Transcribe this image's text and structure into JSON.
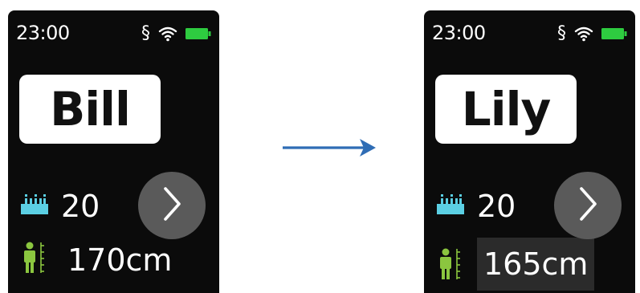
{
  "colors": {
    "screen_background": "#0b0b0b",
    "battery": "#2ecc40",
    "age_icon": "#5bcfe3",
    "height_icon": "#8bc63f",
    "next_button": "#5a5a5a",
    "arrow": "#2f6db5",
    "edited_value_highlight": "#2b2b2b"
  },
  "before": {
    "status": {
      "time": "23:00",
      "signal_glyph": "§"
    },
    "profile": {
      "name": "Bill",
      "age": "20",
      "height": "170cm"
    },
    "icons": [
      "age-cake-icon",
      "height-person-icon",
      "chevron-right-icon",
      "wifi-icon",
      "battery-icon"
    ]
  },
  "after": {
    "status": {
      "time": "23:00",
      "signal_glyph": "§"
    },
    "profile": {
      "name": "Lily",
      "age": "20",
      "height": "165cm"
    },
    "icons": [
      "age-cake-icon",
      "height-person-icon",
      "chevron-right-icon",
      "wifi-icon",
      "battery-icon"
    ]
  },
  "transition_arrow": "arrow-right-icon"
}
